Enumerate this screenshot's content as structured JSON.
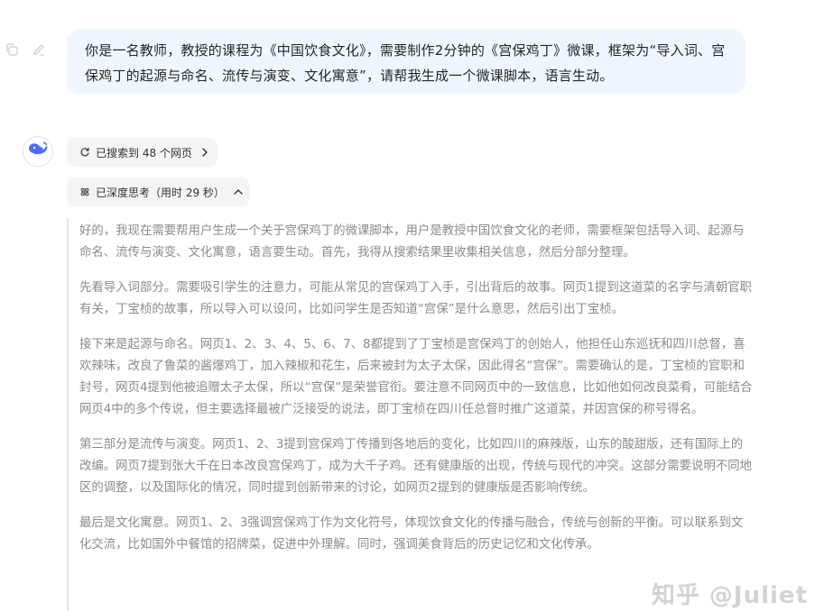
{
  "user_message": {
    "text": "你是一名教师，教授的课程为《中国饮食文化》，需要制作2分钟的《宫保鸡丁》微课，框架为“导入词、宫保鸡丁的起源与命名、流传与演变、文化寓意”，请帮我生成一个微课脚本，语言生动。",
    "actions": [
      {
        "icon": "copy-icon"
      },
      {
        "icon": "edit-icon"
      }
    ]
  },
  "assistant": {
    "avatar_icon": "whale-logo-icon",
    "search_chip": {
      "label": "已搜索到 48 个网页",
      "icon": "search-refresh-icon"
    },
    "think_chip": {
      "label": "已深度思考（用时 29 秒）",
      "icon": "atom-icon"
    },
    "thinking_paragraphs": [
      "好的，我现在需要帮用户生成一个关于宫保鸡丁的微课脚本，用户是教授中国饮食文化的老师，需要框架包括导入词、起源与命名、流传与演变、文化寓意，语言要生动。首先，我得从搜索结果里收集相关信息，然后分部分整理。",
      "先看导入词部分。需要吸引学生的注意力，可能从常见的宫保鸡丁入手，引出背后的故事。网页1提到这道菜的名字与清朝官职有关，丁宝桢的故事，所以导入可以设问，比如问学生是否知道“宫保”是什么意思，然后引出丁宝桢。",
      "接下来是起源与命名。网页1、2、3、4、5、6、7、8都提到了丁宝桢是宫保鸡丁的创始人，他担任山东巡抚和四川总督，喜欢辣味，改良了鲁菜的酱爆鸡丁，加入辣椒和花生，后来被封为太子太保，因此得名“宫保”。需要确认的是，丁宝桢的官职和封号，网页4提到他被追赠太子太保，所以“宫保”是荣誉官衔。要注意不同网页中的一致信息，比如他如何改良菜肴，可能结合网页4中的多个传说，但主要选择最被广泛接受的说法，即丁宝桢在四川任总督时推广这道菜，并因宫保的称号得名。",
      "第三部分是流传与演变。网页1、2、3提到宫保鸡丁传播到各地后的变化，比如四川的麻辣版，山东的酸甜版，还有国际上的改编。网页7提到张大千在日本改良宫保鸡丁，成为大千子鸡。还有健康版的出现，传统与现代的冲突。这部分需要说明不同地区的调整，以及国际化的情况，同时提到创新带来的讨论，如网页2提到的健康版是否影响传统。",
      "最后是文化寓意。网页1、2、3强调宫保鸡丁作为文化符号，体现饮食文化的传播与融合，传统与创新的平衡。可以联系到文化交流，比如国外中餐馆的招牌菜，促进中外理解。同时，强调美食背后的历史记忆和文化传承。"
    ]
  },
  "watermark": {
    "text": "知乎 @Juliet"
  }
}
